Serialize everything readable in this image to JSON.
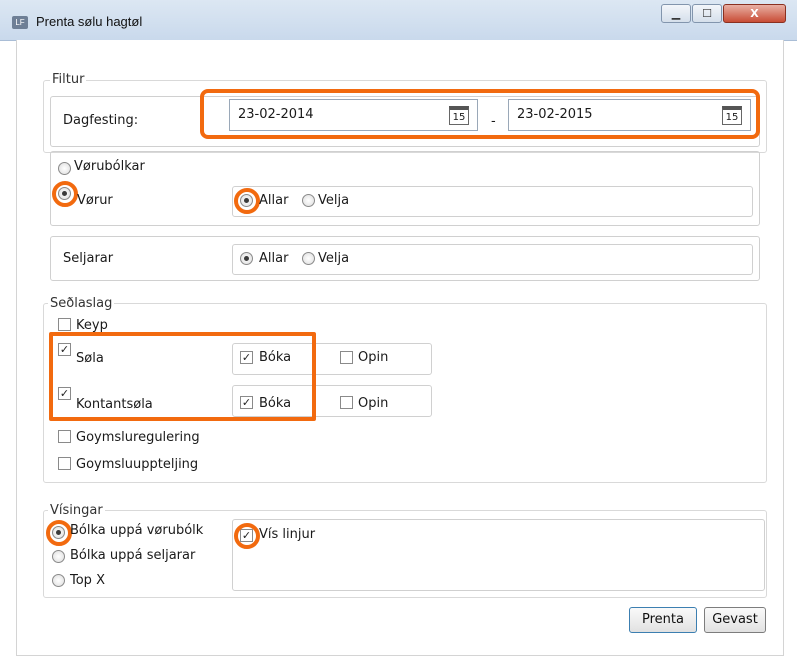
{
  "window": {
    "app_icon_text": "LF",
    "title": "Prenta sølu hagtøl",
    "minimize": "▁",
    "maximize": "☐",
    "close": "X"
  },
  "filtur": {
    "legend": "Filtur",
    "date_label": "Dagfesting:",
    "date_from": "23-02-2014",
    "date_to": "23-02-2015",
    "date_separator": "-",
    "calendar_day": "15"
  },
  "product": {
    "option_groups": "Vørubólkar",
    "option_items": "Vørur",
    "all": "Allar",
    "select": "Velja"
  },
  "sellers": {
    "label": "Seljarar",
    "all": "Allar",
    "select": "Velja"
  },
  "slip": {
    "legend": "Seðlaslag",
    "keyp": "Keyp",
    "sola": "Søla",
    "kontantsola": "Kontantsøla",
    "boka": "Bóka",
    "opin": "Opin",
    "goymsluregulering": "Goymsluregulering",
    "goymsluupptelling": "Goymsluuppteljing"
  },
  "display": {
    "legend": "Vísingar",
    "by_group": "Bólka uppá vørubólk",
    "by_seller": "Bólka uppá seljarar",
    "top_x": "Top X",
    "show_lines": "Vís linjur"
  },
  "buttons": {
    "print": "Prenta",
    "cancel": "Gevast"
  },
  "highlight_color": "#f26a0f"
}
